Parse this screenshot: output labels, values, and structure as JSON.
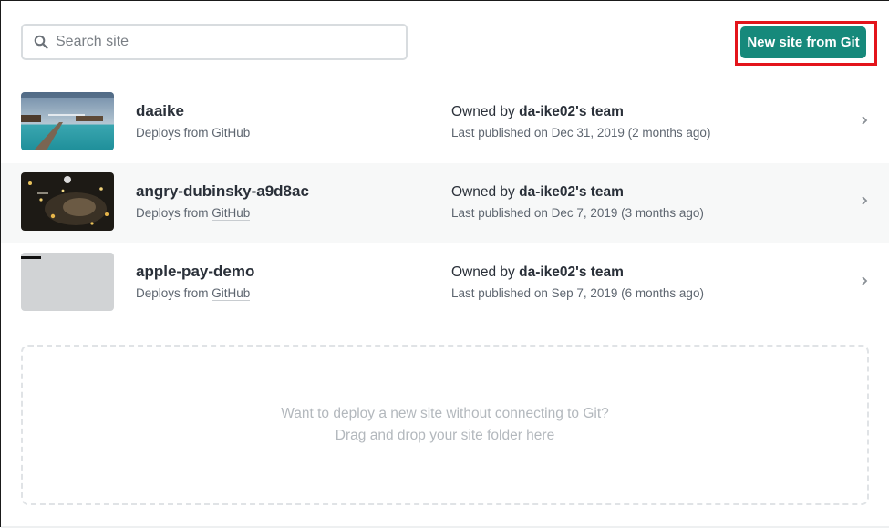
{
  "search": {
    "placeholder": "Search site"
  },
  "toolbar": {
    "new_site_label": "New site from Git"
  },
  "sites": [
    {
      "name": "daaike",
      "deploys_prefix": "Deploys from ",
      "deploys_source": "GitHub",
      "owner_prefix": "Owned by ",
      "owner_team": "da-ike02's team",
      "published": "Last published on Dec 31, 2019 (2 months ago)",
      "thumbnail": "beach-pier-photo"
    },
    {
      "name": "angry-dubinsky-a9d8ac",
      "deploys_prefix": "Deploys from ",
      "deploys_source": "GitHub",
      "owner_prefix": "Owned by ",
      "owner_team": "da-ike02's team",
      "published": "Last published on Dec 7, 2019 (3 months ago)",
      "thumbnail": "dark-bokeh-photo"
    },
    {
      "name": "apple-pay-demo",
      "deploys_prefix": "Deploys from ",
      "deploys_source": "GitHub",
      "owner_prefix": "Owned by ",
      "owner_team": "da-ike02's team",
      "published": "Last published on Sep 7, 2019 (6 months ago)",
      "thumbnail": "blank-gray-page"
    }
  ],
  "dropzone": {
    "line1": "Want to deploy a new site without connecting to Git?",
    "line2": "Drag and drop your site folder here"
  },
  "colors": {
    "accent": "#16897b",
    "highlight_border": "#e3141b"
  }
}
